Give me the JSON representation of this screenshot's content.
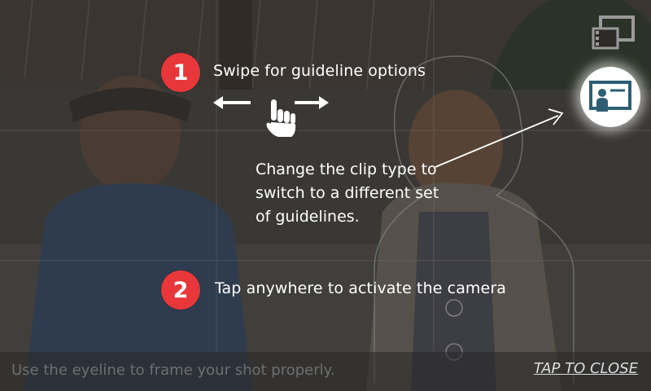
{
  "hints": {
    "step1": {
      "number": "1",
      "text": "Swipe for guideline options"
    },
    "step2": {
      "number": "2",
      "text": "Tap anywhere to activate the camera"
    },
    "clip_type": {
      "lines": [
        "Change the clip type to",
        "switch to a different set",
        "of guidelines."
      ]
    }
  },
  "mode_buttons": {
    "video_icon": "video-clips-icon",
    "photo_icon": "interview-frame-icon",
    "selected": "photo"
  },
  "bottom_bar": {
    "hint": "Use the eyeline to frame your shot properly.",
    "close_label": "TAP TO CLOSE"
  },
  "colors": {
    "badge": "#e8373a",
    "photo_icon_fill": "#2e5e73",
    "text": "#ffffff"
  }
}
